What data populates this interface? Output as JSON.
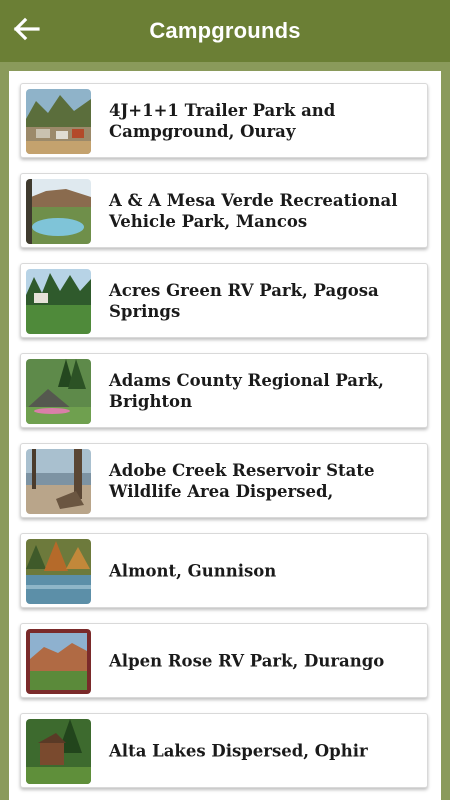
{
  "header": {
    "title": "Campgrounds"
  },
  "campgrounds": [
    {
      "name": "4J+1+1 Trailer Park and Campground, Ouray"
    },
    {
      "name": "A & A Mesa Verde Recreational Vehicle Park, Mancos"
    },
    {
      "name": "Acres Green RV Park, Pagosa Springs"
    },
    {
      "name": "Adams County Regional Park, Brighton"
    },
    {
      "name": "Adobe Creek Reservoir State Wildlife Area Dispersed,"
    },
    {
      "name": "Almont, Gunnison"
    },
    {
      "name": "Alpen Rose RV Park, Durango"
    },
    {
      "name": "Alta Lakes Dispersed, Ophir"
    }
  ],
  "colors": {
    "header": "#6b7f35",
    "background": "#8a9a5b",
    "card": "#ffffff"
  }
}
